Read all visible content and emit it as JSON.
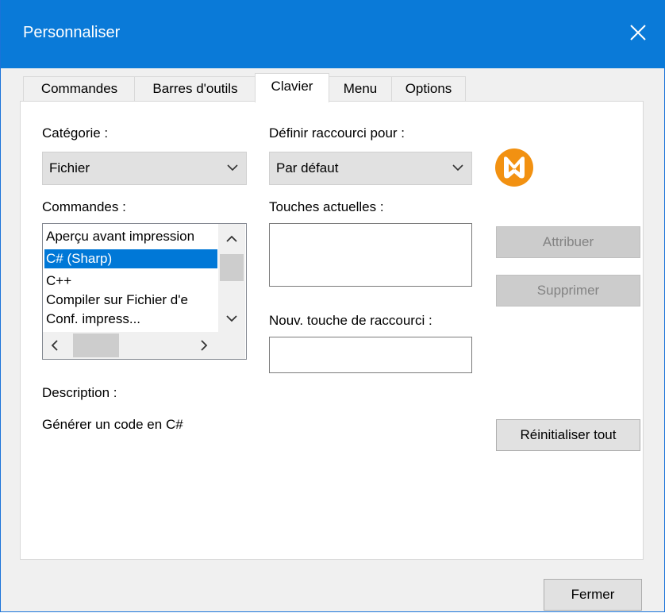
{
  "window": {
    "title": "Personnaliser"
  },
  "tabs": [
    {
      "label": "Commandes"
    },
    {
      "label": "Barres d'outils"
    },
    {
      "label": "Clavier",
      "active": true
    },
    {
      "label": "Menu"
    },
    {
      "label": "Options"
    }
  ],
  "categorie": {
    "label": "Catégorie :",
    "value": "Fichier"
  },
  "definir": {
    "label": "Définir raccourci pour :",
    "value": "Par défaut"
  },
  "commandes": {
    "label": "Commandes :",
    "items": [
      "Aperçu avant impression",
      "C# (Sharp)",
      "C++",
      "Compiler sur Fichier d'e",
      "Conf. impress..."
    ],
    "selected_index": 1
  },
  "touches_actuelles": {
    "label": "Touches actuelles :"
  },
  "nouv_touche": {
    "label": "Nouv. touche de raccourci :",
    "value": ""
  },
  "description": {
    "label": "Description :",
    "text": "Générer un code en C#"
  },
  "buttons": {
    "attribuer": "Attribuer",
    "supprimer": "Supprimer",
    "reinitialiser": "Réinitialiser tout",
    "fermer": "Fermer"
  },
  "colors": {
    "titlebar": "#0a7ad8",
    "selection": "#0078d7",
    "logo": "#f29111"
  },
  "icons": {
    "close": "close-icon",
    "logo": "altova-logo-icon"
  }
}
